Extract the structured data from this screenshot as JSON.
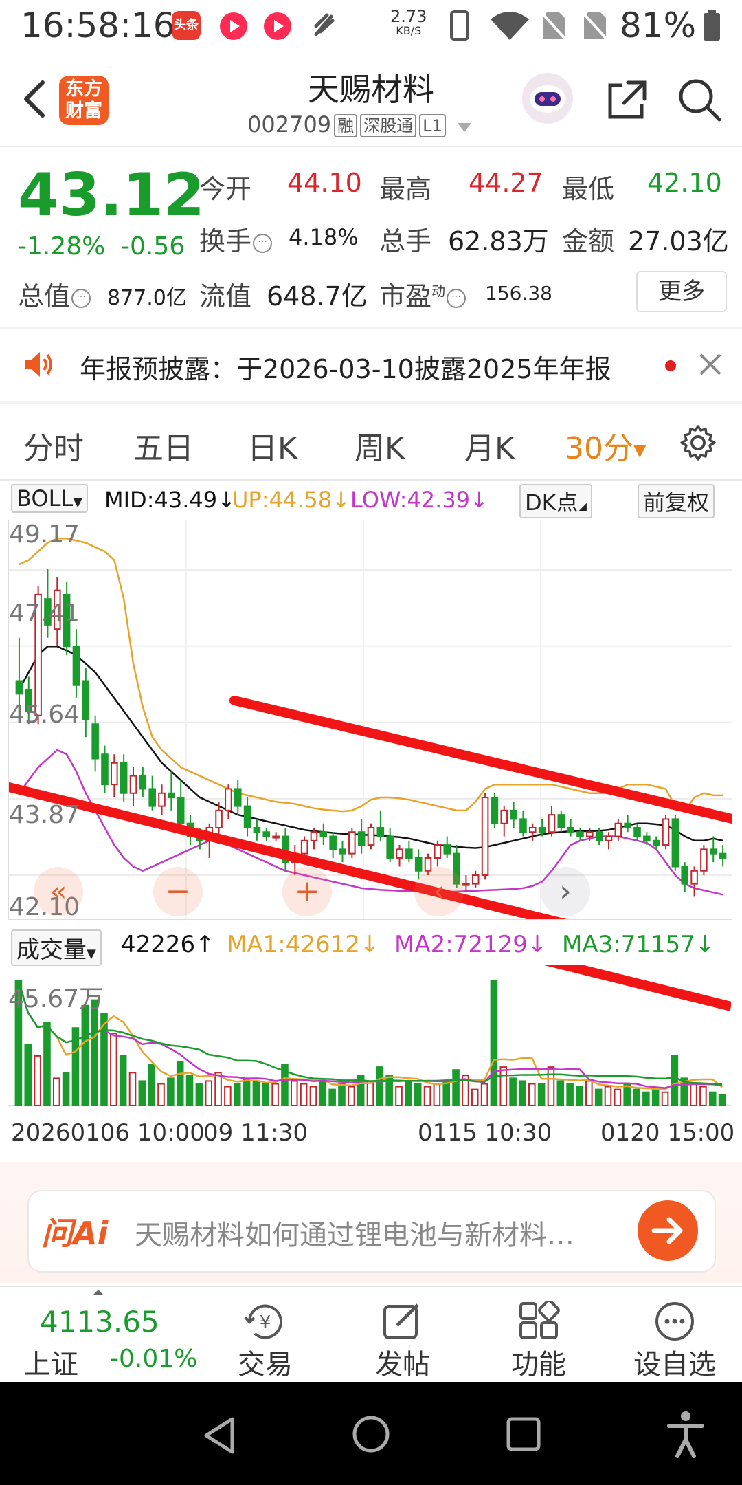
{
  "status_bar": {
    "time": "16:58:16",
    "net_speed_value": "2.73",
    "net_speed_unit": "KB/S",
    "battery": "81%",
    "app_badge": "头条"
  },
  "header": {
    "logo_text_1": "东方",
    "logo_text_2": "财富",
    "title": "天赐材料",
    "code": "002709",
    "tags": [
      "融",
      "深股通",
      "L1"
    ]
  },
  "quote": {
    "price": "43.12",
    "change_pct": "-1.28%",
    "change_abs": "-0.56",
    "open_label": "今开",
    "open": "44.10",
    "high_label": "最高",
    "high": "44.27",
    "low_label": "最低",
    "low": "42.10",
    "turnover_label": "换手",
    "turnover": "4.18%",
    "volume_label": "总手",
    "volume": "62.83万",
    "amount_label": "金额",
    "amount": "27.03亿",
    "mktcap_label": "总值",
    "mktcap": "877.0亿",
    "float_label": "流值",
    "float": "648.7亿",
    "pe_label": "市盈",
    "pe_sup": "动",
    "pe": "156.38",
    "more": "更多"
  },
  "notice": {
    "text": "年报预披露：于2026-03-10披露2025年年报"
  },
  "tabs": [
    "分时",
    "五日",
    "日K",
    "周K",
    "月K",
    "30分"
  ],
  "indicator": {
    "name": "BOLL",
    "mid": "MID:43.49",
    "up": "UP:44.58",
    "low": "LOW:42.39",
    "dk": "DK点",
    "fq": "前复权"
  },
  "price_axis": [
    "49.17",
    "47.41",
    "45.64",
    "43.87",
    "42.10"
  ],
  "volume_bar": {
    "name": "成交量",
    "value": "42226",
    "ma1": "MA1:42612",
    "ma2": "MA2:72129",
    "ma3": "MA3:71157",
    "axis_max": "45.67万"
  },
  "time_axis": [
    "20260106 10:00",
    "09 11:30",
    "0115 10:30",
    "0120 15:00"
  ],
  "chart_controls": [
    "«",
    "−",
    "+",
    "‹",
    "›"
  ],
  "ai": {
    "logo": "问Ai",
    "prompt": "天赐材料如何通过锂电池与新材料…"
  },
  "bottom": {
    "index_value": "4113.65",
    "index_name": "上证",
    "index_change": "-0.01%",
    "items": [
      "交易",
      "发帖",
      "功能",
      "设自选"
    ]
  },
  "colors": {
    "up": "#d9262c",
    "down": "#1a9c2c",
    "accent": "#e8841a",
    "boll_up": "#e8a42a",
    "boll_low": "#c436c8",
    "mid": "#111111"
  },
  "chart_data": {
    "type": "candlestick",
    "candles": [
      [
        46.6,
        47.6,
        45.8,
        46.3
      ],
      [
        46.4,
        46.7,
        45.6,
        45.9
      ],
      [
        45.8,
        48.8,
        45.6,
        48.6
      ],
      [
        48.5,
        49.2,
        47.6,
        47.9
      ],
      [
        47.8,
        49.0,
        47.4,
        48.7
      ],
      [
        48.6,
        48.9,
        47.2,
        47.4
      ],
      [
        47.4,
        47.8,
        46.2,
        46.5
      ],
      [
        46.6,
        46.9,
        45.3,
        45.7
      ],
      [
        45.6,
        45.8,
        44.5,
        44.8
      ],
      [
        44.9,
        45.1,
        44.0,
        44.2
      ],
      [
        44.2,
        44.9,
        43.9,
        44.7
      ],
      [
        44.7,
        44.9,
        43.8,
        44.0
      ],
      [
        44.0,
        44.6,
        43.7,
        44.4
      ],
      [
        44.4,
        44.6,
        43.9,
        44.1
      ],
      [
        44.1,
        44.4,
        43.6,
        43.7
      ],
      [
        43.7,
        44.2,
        43.5,
        44.0
      ],
      [
        44.0,
        44.5,
        43.6,
        43.9
      ],
      [
        43.9,
        44.3,
        43.1,
        43.3
      ],
      [
        43.3,
        43.5,
        42.8,
        43.0
      ],
      [
        43.0,
        43.2,
        42.7,
        42.9
      ],
      [
        42.9,
        43.3,
        42.5,
        43.2
      ],
      [
        43.2,
        43.8,
        42.9,
        43.6
      ],
      [
        43.6,
        44.2,
        43.4,
        44.1
      ],
      [
        44.1,
        44.3,
        43.5,
        43.7
      ],
      [
        43.7,
        43.9,
        43.0,
        43.2
      ],
      [
        43.2,
        43.4,
        42.9,
        43.1
      ],
      [
        43.1,
        43.2,
        42.9,
        43.0
      ],
      [
        43.0,
        43.1,
        42.9,
        43.0
      ],
      [
        43.0,
        43.2,
        42.2,
        42.4
      ],
      [
        42.4,
        42.8,
        42.1,
        42.6
      ],
      [
        42.6,
        43.0,
        42.4,
        42.9
      ],
      [
        42.9,
        43.2,
        42.7,
        43.1
      ],
      [
        43.1,
        43.3,
        42.8,
        43.0
      ],
      [
        43.0,
        43.1,
        42.5,
        42.7
      ],
      [
        42.7,
        42.9,
        42.4,
        42.6
      ],
      [
        42.6,
        43.2,
        42.5,
        43.1
      ],
      [
        43.1,
        43.4,
        42.6,
        42.8
      ],
      [
        42.8,
        43.3,
        42.7,
        43.2
      ],
      [
        43.2,
        43.6,
        42.9,
        43.0
      ],
      [
        43.0,
        43.2,
        42.4,
        42.5
      ],
      [
        42.5,
        42.8,
        42.3,
        42.7
      ],
      [
        42.7,
        42.9,
        42.4,
        42.5
      ],
      [
        42.5,
        42.7,
        42.0,
        42.2
      ],
      [
        42.2,
        42.6,
        42.1,
        42.5
      ],
      [
        42.5,
        42.9,
        42.3,
        42.8
      ],
      [
        42.8,
        43.0,
        42.5,
        42.6
      ],
      [
        42.6,
        42.8,
        41.8,
        41.9
      ],
      [
        41.9,
        42.1,
        41.7,
        41.9
      ],
      [
        41.9,
        42.2,
        41.8,
        42.1
      ],
      [
        42.1,
        44.0,
        42.0,
        43.9
      ],
      [
        43.9,
        44.0,
        43.2,
        43.3
      ],
      [
        43.3,
        43.7,
        43.0,
        43.6
      ],
      [
        43.6,
        43.8,
        43.2,
        43.4
      ],
      [
        43.4,
        43.6,
        43.0,
        43.1
      ],
      [
        43.1,
        43.3,
        42.9,
        43.2
      ],
      [
        43.2,
        43.4,
        43.0,
        43.1
      ],
      [
        43.1,
        43.7,
        43.0,
        43.5
      ],
      [
        43.5,
        43.6,
        43.1,
        43.2
      ],
      [
        43.2,
        43.4,
        43.0,
        43.1
      ],
      [
        43.1,
        43.2,
        42.9,
        43.0
      ],
      [
        43.0,
        43.2,
        42.9,
        43.1
      ],
      [
        43.1,
        43.2,
        42.8,
        42.9
      ],
      [
        42.9,
        43.1,
        42.7,
        43.0
      ],
      [
        43.0,
        43.4,
        42.9,
        43.3
      ],
      [
        43.3,
        43.5,
        43.1,
        43.2
      ],
      [
        43.2,
        43.3,
        42.9,
        43.0
      ],
      [
        43.0,
        43.1,
        42.8,
        42.9
      ],
      [
        42.9,
        43.0,
        42.7,
        42.8
      ],
      [
        42.8,
        43.5,
        42.7,
        43.4
      ],
      [
        43.4,
        43.5,
        42.2,
        42.3
      ],
      [
        42.3,
        42.4,
        41.7,
        41.9
      ],
      [
        41.9,
        42.3,
        41.6,
        42.2
      ],
      [
        42.2,
        42.8,
        42.1,
        42.7
      ],
      [
        42.7,
        43.0,
        42.4,
        42.6
      ],
      [
        42.6,
        42.8,
        42.3,
        42.5
      ]
    ],
    "boll_mid": [
      46.4,
      46.8,
      47.2,
      47.4,
      47.4,
      47.3,
      47.2,
      47.0,
      46.8,
      46.5,
      46.2,
      45.9,
      45.6,
      45.3,
      45.0,
      44.7,
      44.5,
      44.3,
      44.1,
      43.9,
      43.8,
      43.7,
      43.6,
      43.5,
      43.45,
      43.4,
      43.35,
      43.3,
      43.25,
      43.2,
      43.15,
      43.12,
      43.1,
      43.08,
      43.06,
      43.05,
      43.04,
      43.03,
      43.02,
      43.0,
      42.98,
      42.95,
      42.9,
      42.85,
      42.8,
      42.78,
      42.76,
      42.74,
      42.73,
      42.75,
      42.8,
      42.85,
      42.9,
      42.95,
      43.0,
      43.05,
      43.08,
      43.1,
      43.12,
      43.12,
      43.12,
      43.13,
      43.15,
      43.2,
      43.25,
      43.3,
      43.3,
      43.28,
      43.25,
      43.15,
      43.0,
      42.9,
      42.9,
      42.95,
      42.9
    ],
    "boll_up": [
      49.3,
      49.4,
      49.6,
      49.8,
      49.9,
      49.9,
      49.85,
      49.8,
      49.7,
      49.6,
      49.4,
      48.5,
      47.0,
      46.0,
      45.3,
      45.0,
      44.8,
      44.6,
      44.5,
      44.4,
      44.3,
      44.2,
      44.1,
      44.0,
      43.95,
      43.9,
      43.85,
      43.8,
      43.78,
      43.75,
      43.7,
      43.65,
      43.62,
      43.6,
      43.58,
      43.6,
      43.7,
      43.85,
      43.9,
      43.9,
      43.88,
      43.85,
      43.8,
      43.75,
      43.7,
      43.65,
      43.6,
      43.6,
      43.8,
      44.1,
      44.2,
      44.2,
      44.2,
      44.2,
      44.2,
      44.2,
      44.2,
      44.15,
      44.1,
      44.05,
      44.0,
      44.0,
      44.0,
      44.1,
      44.2,
      44.2,
      44.2,
      44.15,
      44.1,
      43.7,
      43.6,
      43.9,
      44.0,
      43.95,
      43.95
    ],
    "boll_low": [
      44.0,
      44.3,
      44.6,
      44.8,
      45.0,
      44.9,
      44.5,
      44.0,
      43.6,
      43.2,
      42.8,
      42.5,
      42.3,
      42.2,
      42.3,
      42.4,
      42.5,
      42.6,
      42.7,
      42.8,
      42.9,
      42.9,
      42.8,
      42.7,
      42.6,
      42.5,
      42.4,
      42.3,
      42.2,
      42.15,
      42.1,
      42.05,
      42.0,
      41.95,
      41.9,
      41.85,
      41.8,
      41.78,
      41.76,
      41.75,
      41.74,
      41.74,
      41.73,
      41.72,
      41.72,
      41.72,
      41.72,
      41.73,
      41.74,
      41.75,
      41.76,
      41.77,
      41.78,
      41.8,
      41.85,
      41.95,
      42.2,
      42.5,
      42.8,
      42.9,
      42.95,
      43.0,
      43.0,
      43.0,
      42.95,
      42.9,
      42.85,
      42.7,
      42.4,
      42.1,
      41.9,
      41.8,
      41.75,
      41.7,
      41.65
    ],
    "volumes": [
      45.0,
      22.0,
      18.0,
      30.0,
      10.0,
      12.0,
      28.0,
      36.0,
      38.0,
      33.0,
      26.0,
      18.0,
      12.0,
      9.0,
      15.0,
      8.0,
      10.0,
      16.0,
      11.0,
      8.0,
      9.0,
      12.0,
      7.0,
      8.0,
      10.0,
      9.0,
      8.0,
      8.0,
      15.0,
      9.0,
      8.0,
      7.0,
      9.0,
      6.0,
      8.0,
      7.0,
      11.0,
      9.0,
      14.0,
      11.0,
      7.0,
      9.0,
      8.0,
      7.0,
      8.0,
      9.0,
      13.0,
      11.0,
      6.0,
      8.0,
      45.0,
      14.0,
      10.0,
      9.0,
      8.0,
      8.0,
      14.0,
      9.0,
      8.0,
      7.0,
      9.0,
      6.0,
      7.0,
      6.0,
      8.0,
      6.0,
      5.0,
      6.0,
      5.0,
      18.0,
      10.0,
      8.0,
      7.0,
      5.0,
      4.0
    ],
    "y_range": [
      42.1,
      49.17
    ],
    "volume_max": 45.67
  },
  "chart_labels": {
    "price_axis_unit": "",
    "volume_unit": "万"
  },
  "chart_range_note": "",
  "chart_colors": {
    "candle_up": "#c0282e",
    "candle_down": "#1a9c2c"
  },
  "chart_type": "candlestick"
}
